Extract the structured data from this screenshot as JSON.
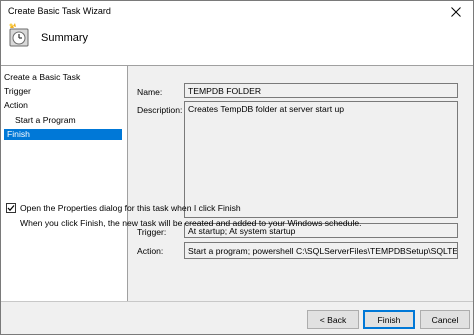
{
  "window": {
    "title": "Create Basic Task Wizard"
  },
  "header": {
    "title": "Summary"
  },
  "nav": {
    "items": [
      {
        "label": "Create a Basic Task"
      },
      {
        "label": "Trigger"
      },
      {
        "label": "Action"
      },
      {
        "label": "Start a Program"
      },
      {
        "label": "Finish"
      }
    ],
    "selected": "Finish"
  },
  "summary": {
    "name_label": "Name:",
    "name_value": "TEMPDB FOLDER",
    "description_label": "Description:",
    "description_value": "Creates TempDB folder at server start up",
    "trigger_label": "Trigger:",
    "trigger_value": "At startup; At system startup",
    "action_label": "Action:",
    "action_value": "Start a program; powershell C:\\SQLServerFiles\\TEMPDBSetup\\SQLTEMPDBIni"
  },
  "options": {
    "open_properties_label": "Open the Properties dialog for this task when I click Finish",
    "open_properties_checked": true,
    "info_text": "When you click Finish, the new task will be created and added to your Windows schedule."
  },
  "footer": {
    "back_label": "< Back",
    "finish_label": "Finish",
    "cancel_label": "Cancel"
  },
  "colors": {
    "selection": "#0078d7",
    "panel_background": "#f0f0f0"
  }
}
